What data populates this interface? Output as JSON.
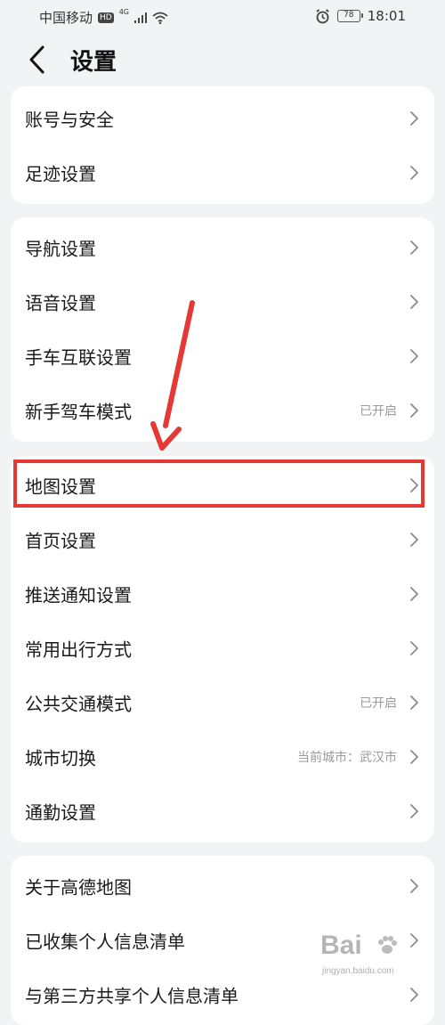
{
  "status_bar": {
    "carrier": "中国移动",
    "hd": "HD",
    "network": "4G",
    "battery": "78",
    "time": "18:01"
  },
  "header": {
    "title": "设置"
  },
  "groups": [
    {
      "items": [
        {
          "label": "账号与安全",
          "value": ""
        },
        {
          "label": "足迹设置",
          "value": ""
        }
      ]
    },
    {
      "items": [
        {
          "label": "导航设置",
          "value": ""
        },
        {
          "label": "语音设置",
          "value": ""
        },
        {
          "label": "手车互联设置",
          "value": ""
        },
        {
          "label": "新手驾车模式",
          "value": "已开启"
        }
      ]
    },
    {
      "items": [
        {
          "label": "地图设置",
          "value": ""
        },
        {
          "label": "首页设置",
          "value": ""
        },
        {
          "label": "推送通知设置",
          "value": ""
        },
        {
          "label": "常用出行方式",
          "value": ""
        },
        {
          "label": "公共交通模式",
          "value": "已开启"
        },
        {
          "label": "城市切换",
          "value": "当前城市：武汉市"
        },
        {
          "label": "通勤设置",
          "value": ""
        }
      ]
    },
    {
      "items": [
        {
          "label": "关于高德地图",
          "value": ""
        },
        {
          "label": "已收集个人信息清单",
          "value": ""
        },
        {
          "label": "与第三方共享个人信息清单",
          "value": ""
        }
      ]
    }
  ],
  "watermark": {
    "logo": "Bai",
    "url": "jingyan.baidu.com"
  },
  "colors": {
    "background": "#f2f3f5",
    "card": "#ffffff",
    "annotation": "#e53935",
    "secondary_text": "#9a9a9a"
  }
}
